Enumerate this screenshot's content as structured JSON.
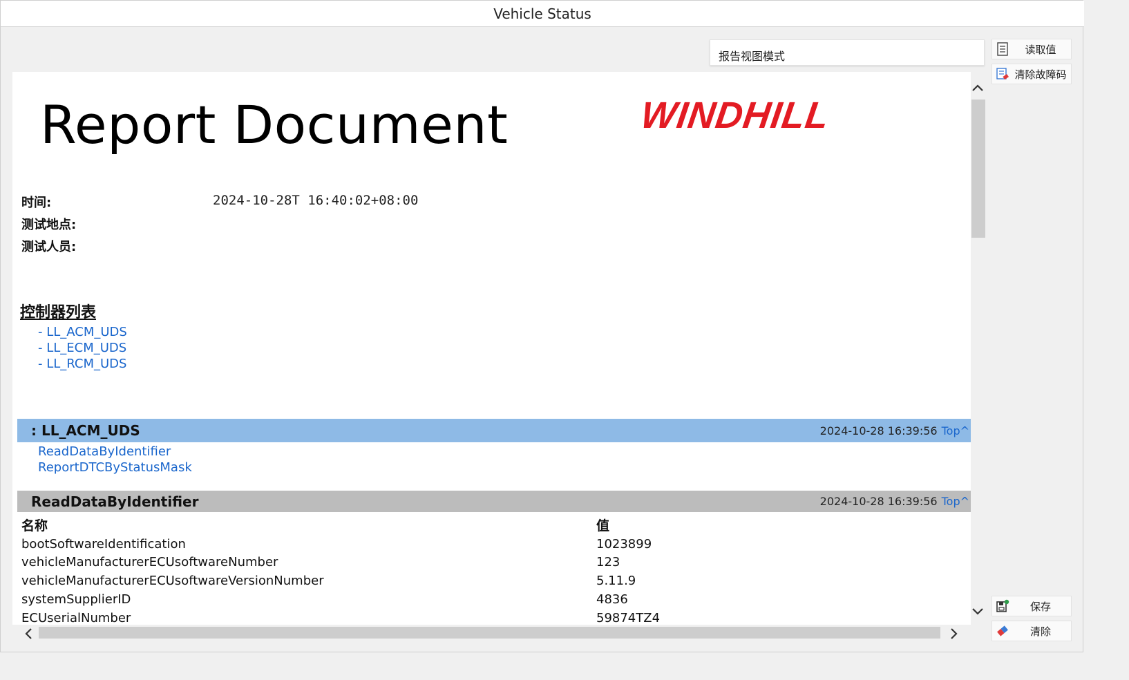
{
  "window": {
    "title": "Vehicle Status"
  },
  "toolbar": {
    "view_mode": "报告视图模式",
    "read_values": "读取值",
    "clear_dtc": "清除故障码",
    "save": "保存",
    "clear": "清除"
  },
  "report": {
    "title": "Report Document",
    "logo": "WINDHILL",
    "time_label": "时间:",
    "time_value": "2024-10-28T 16:40:02+08:00",
    "location_label": "测试地点:",
    "tester_label": "测试人员:",
    "controller_list_heading": "控制器列表",
    "controllers": [
      "- LL_ACM_UDS",
      "- LL_ECM_UDS",
      "- LL_RCM_UDS"
    ],
    "ecu_section": {
      "title": ": LL_ACM_UDS",
      "date": "2024-10-28 16:39:56",
      "top": "Top^",
      "services": [
        "ReadDataByIdentifier",
        "ReportDTCByStatusMask"
      ]
    },
    "rdbi_section": {
      "title": "ReadDataByIdentifier",
      "date": "2024-10-28 16:39:56",
      "top": "Top^",
      "col_name": "名称",
      "col_value": "值",
      "rows": [
        {
          "name": "bootSoftwareIdentification",
          "value": "1023899"
        },
        {
          "name": "vehicleManufacturerECUsoftwareNumber",
          "value": "123"
        },
        {
          "name": "vehicleManufacturerECUsoftwareVersionNumber",
          "value": "5.11.9"
        },
        {
          "name": "systemSupplierID",
          "value": "4836"
        },
        {
          "name": "ECUserialNumber",
          "value": "59874TZ4"
        }
      ]
    }
  },
  "colors": {
    "logo": "#e31b23",
    "ecu_bar": "#8ebae6",
    "service_bar": "#bcbcbc",
    "link": "#1a66cc"
  }
}
